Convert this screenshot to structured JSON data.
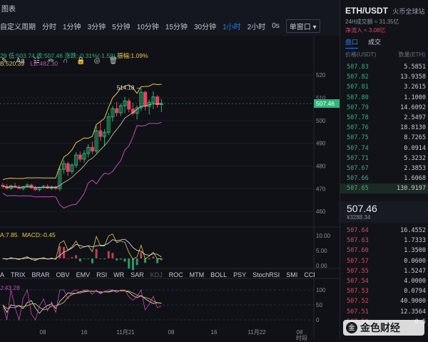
{
  "toolbar": {
    "chart_label": "图表",
    "custom_period": "自定义周期",
    "intervals": [
      "分时",
      "1分钟",
      "3分钟",
      "5分钟",
      "10分钟",
      "15分钟",
      "30分钟",
      "1小时",
      "2小时",
      "0s"
    ],
    "active_interval": "1小时",
    "window_select": "单窗口",
    "chevron": "▾"
  },
  "ohlc_bar": {
    "open_low_prefix": "29",
    "low": "低:503.74",
    "close": "收:507.46",
    "change": "涨跌:-0.31%(-1.59)",
    "amplitude": "振幅:1.09%",
    "mb": "B:520.39",
    "lb": "LB:482.30"
  },
  "chart_data": {
    "type": "candlestick",
    "symbol": "ETH/USDT",
    "interval": "1小时",
    "price_axis": {
      "ticks": [
        520.0,
        510.0,
        500.0,
        490.0,
        480.0,
        470.0,
        460.0
      ],
      "range": [
        455,
        526
      ]
    },
    "last_price": 507.46,
    "max_annotation": "514.18",
    "candles": [
      {
        "o": 471.5,
        "h": 472.5,
        "l": 470.2,
        "c": 471.0
      },
      {
        "o": 471.0,
        "h": 472.0,
        "l": 469.6,
        "c": 470.2
      },
      {
        "o": 470.2,
        "h": 471.8,
        "l": 469.5,
        "c": 471.2
      },
      {
        "o": 471.2,
        "h": 472.6,
        "l": 470.5,
        "c": 470.6
      },
      {
        "o": 470.6,
        "h": 471.6,
        "l": 469.8,
        "c": 470.1
      },
      {
        "o": 470.1,
        "h": 471.2,
        "l": 469.2,
        "c": 470.9
      },
      {
        "o": 470.9,
        "h": 472.4,
        "l": 470.3,
        "c": 471.6
      },
      {
        "o": 471.6,
        "h": 472.2,
        "l": 470.0,
        "c": 470.4
      },
      {
        "o": 470.4,
        "h": 471.3,
        "l": 469.0,
        "c": 469.6
      },
      {
        "o": 469.6,
        "h": 470.9,
        "l": 468.8,
        "c": 470.5
      },
      {
        "o": 470.5,
        "h": 471.7,
        "l": 469.9,
        "c": 471.0
      },
      {
        "o": 471.0,
        "h": 471.9,
        "l": 469.9,
        "c": 470.2
      },
      {
        "o": 470.2,
        "h": 471.4,
        "l": 469.5,
        "c": 470.8
      },
      {
        "o": 470.8,
        "h": 471.3,
        "l": 469.6,
        "c": 470.1
      },
      {
        "o": 470.1,
        "h": 480.0,
        "l": 469.0,
        "c": 478.5
      },
      {
        "o": 478.5,
        "h": 482.5,
        "l": 476.6,
        "c": 481.0
      },
      {
        "o": 481.0,
        "h": 481.8,
        "l": 475.5,
        "c": 477.6
      },
      {
        "o": 477.6,
        "h": 481.2,
        "l": 476.4,
        "c": 480.4
      },
      {
        "o": 480.4,
        "h": 486.0,
        "l": 479.2,
        "c": 484.8
      },
      {
        "o": 484.8,
        "h": 486.4,
        "l": 481.8,
        "c": 483.0
      },
      {
        "o": 483.0,
        "h": 487.0,
        "l": 481.5,
        "c": 485.5
      },
      {
        "o": 485.5,
        "h": 489.6,
        "l": 483.8,
        "c": 488.2
      },
      {
        "o": 488.2,
        "h": 490.8,
        "l": 485.2,
        "c": 486.6
      },
      {
        "o": 486.6,
        "h": 497.5,
        "l": 485.6,
        "c": 495.5
      },
      {
        "o": 495.5,
        "h": 499.2,
        "l": 491.0,
        "c": 493.0
      },
      {
        "o": 493.0,
        "h": 496.2,
        "l": 488.8,
        "c": 494.8
      },
      {
        "o": 494.8,
        "h": 503.4,
        "l": 493.6,
        "c": 501.6
      },
      {
        "o": 501.6,
        "h": 506.4,
        "l": 499.6,
        "c": 505.2
      },
      {
        "o": 505.2,
        "h": 508.2,
        "l": 501.8,
        "c": 503.4
      },
      {
        "o": 503.4,
        "h": 507.4,
        "l": 502.0,
        "c": 506.5
      },
      {
        "o": 506.5,
        "h": 510.4,
        "l": 503.2,
        "c": 508.6
      },
      {
        "o": 508.6,
        "h": 509.6,
        "l": 503.6,
        "c": 505.0
      },
      {
        "o": 505.0,
        "h": 507.8,
        "l": 502.2,
        "c": 503.2
      },
      {
        "o": 503.2,
        "h": 506.6,
        "l": 500.4,
        "c": 505.6
      },
      {
        "o": 505.6,
        "h": 514.2,
        "l": 504.2,
        "c": 512.4
      },
      {
        "o": 512.4,
        "h": 513.0,
        "l": 504.4,
        "c": 506.2
      },
      {
        "o": 506.2,
        "h": 509.2,
        "l": 502.6,
        "c": 508.0
      },
      {
        "o": 508.0,
        "h": 512.8,
        "l": 505.0,
        "c": 510.4
      },
      {
        "o": 510.4,
        "h": 511.2,
        "l": 505.6,
        "c": 507.0
      },
      {
        "o": 507.0,
        "h": 509.5,
        "l": 503.7,
        "c": 507.46
      }
    ],
    "macd_axis": {
      "ticks": [
        "10.00",
        "5.00",
        "0.00"
      ]
    },
    "kdj_axis": {
      "ticks": [
        "100",
        "50",
        "0"
      ]
    },
    "date_axis": [
      "08",
      "16",
      "11月21",
      "08",
      "16",
      "11月22",
      "08"
    ],
    "bottom_time": "时段"
  },
  "indicators": {
    "macd_label": "A:7.85",
    "macd_value": "MACD:-0.45",
    "kdj_value": "J:43.28",
    "tabs": [
      "A",
      "TRIX",
      "BRAR",
      "OBV",
      "EMV",
      "RSI",
      "WR",
      "SAR",
      "KDJ",
      "ROC",
      "MTM",
      "BOLL",
      "PSY",
      "StochRSI",
      "SMI",
      "CCI"
    ],
    "active_tab": "KDJ"
  },
  "header": {
    "pair": "ETH/USDT",
    "venue": "火币全球站",
    "vol_24h": "24H成交额 ≈ 31.35亿",
    "net_inflow": "净流入 ≈ 3.08亿",
    "tabs": [
      "盘口",
      "成交"
    ],
    "active_tab": "盘口",
    "col_price": "价格(USDT)",
    "col_qty": "数量(ETH)"
  },
  "orderbook": {
    "bids": [
      {
        "price": "507.83",
        "qty": "5.5851"
      },
      {
        "price": "507.82",
        "qty": "13.9358"
      },
      {
        "price": "507.81",
        "qty": "3.2615"
      },
      {
        "price": "507.80",
        "qty": "1.1000"
      },
      {
        "price": "507.79",
        "qty": "14.6092"
      },
      {
        "price": "507.78",
        "qty": "2.5497"
      },
      {
        "price": "507.76",
        "qty": "18.8130"
      },
      {
        "price": "507.75",
        "qty": "8.7265"
      },
      {
        "price": "507.74",
        "qty": "0.0914"
      },
      {
        "price": "507.71",
        "qty": "5.3232"
      },
      {
        "price": "507.67",
        "qty": "2.3853"
      },
      {
        "price": "507.66",
        "qty": "1.6068"
      },
      {
        "price": "507.65",
        "qty": "130.9197"
      }
    ],
    "last_price": "507.46",
    "last_cny": "¥3288.34",
    "asks": [
      {
        "price": "507.64",
        "qty": "16.4552"
      },
      {
        "price": "507.63",
        "qty": "1.7333"
      },
      {
        "price": "507.60",
        "qty": "1.3500"
      },
      {
        "price": "507.57",
        "qty": "0.0600"
      },
      {
        "price": "507.55",
        "qty": "1.5247"
      },
      {
        "price": "507.54",
        "qty": "4.0000"
      },
      {
        "price": "507.53",
        "qty": "0.0794"
      },
      {
        "price": "507.52",
        "qty": "40.9000"
      },
      {
        "price": "507.51",
        "qty": "12.3564"
      },
      {
        "price": "507.50",
        "qty": "0.5"
      }
    ]
  },
  "watermark": {
    "text": "金色财经",
    "logo": "金"
  },
  "colors": {
    "up": "#2fb47a",
    "down": "#e0465f",
    "accent": "#2d7de8",
    "bg": "#0f1116"
  }
}
